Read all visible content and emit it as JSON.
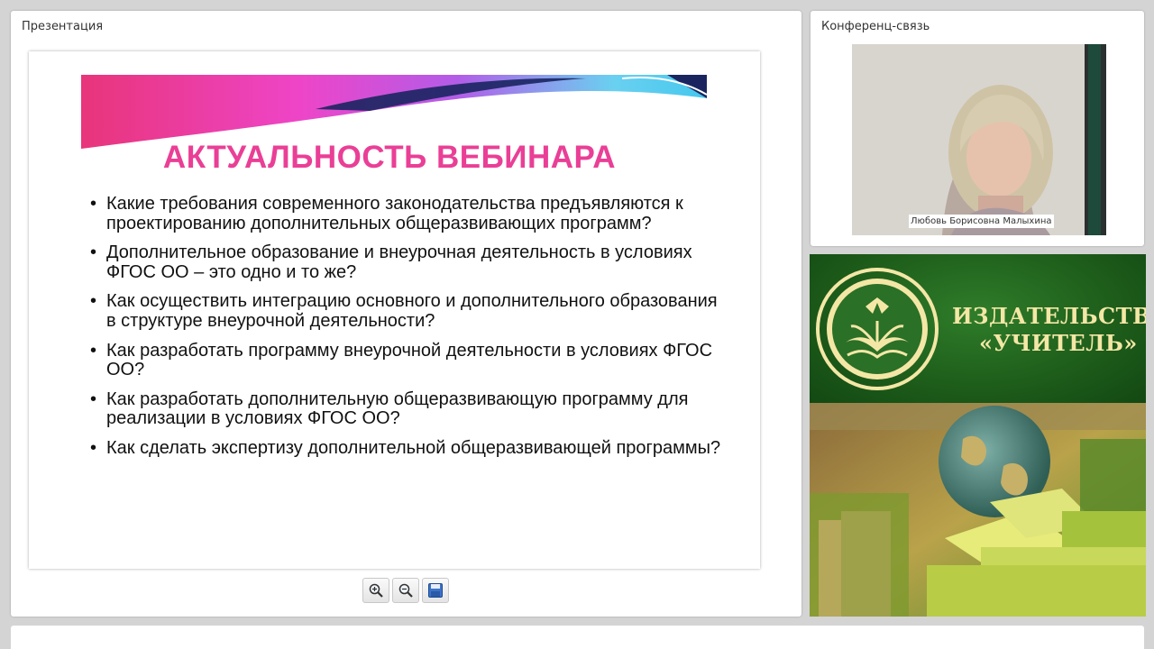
{
  "presentation": {
    "panel_title": "Презентация",
    "slide": {
      "title": "АКТУАЛЬНОСТЬ ВЕБИНАРА",
      "bullets": [
        "Какие требования современного законодательства предъявляются к проектированию дополнительных общеразвивающих программ?",
        "Дополнительное образование и внеурочная деятельность в условиях ФГОС ОО – это одно и то же?",
        "Как осуществить интеграцию основного и дополнительного образования в структуре внеурочной деятельности?",
        "Как разработать программу внеурочной деятельности в условиях ФГОС ОО?",
        "Как разработать дополнительную общеразвивающую программу для реализации в условиях ФГОС ОО?",
        "Как сделать экспертизу дополнительной общеразвивающей программы?"
      ],
      "bullet_symbol": "•",
      "title_color": "#ea3f96"
    },
    "toolbar": {
      "zoom_in_icon": "zoom-in-icon",
      "zoom_out_icon": "zoom-out-icon",
      "save_icon": "save-icon"
    }
  },
  "conference": {
    "panel_title": "Конференц-связь",
    "participant_name": "Любовь Борисовна Малыхина"
  },
  "publisher": {
    "name_line_1": "ИЗДАТЕЛЬСТВО",
    "name_line_2": "«УЧИТЕЛЬ»",
    "text_color": "#f4e7a6"
  }
}
